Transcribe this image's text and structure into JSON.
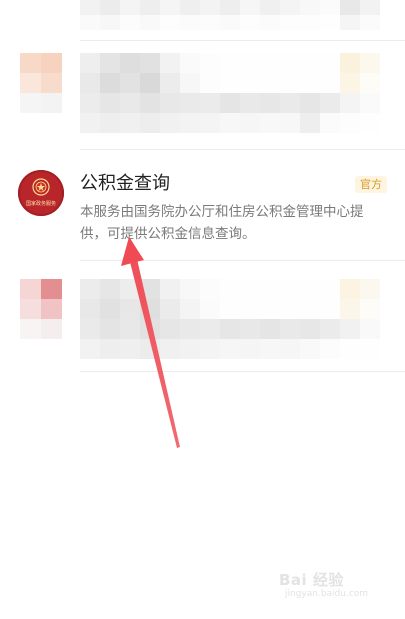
{
  "result_item": {
    "title": "公积金查询",
    "badge": "官方",
    "description": "本服务由国务院办公厅和住房公积金管理中心提供，可提供公积金信息查询。",
    "emblem_text": "国家政务服务"
  },
  "watermark": {
    "main": "Bai 经验",
    "sub": "jingyan.baidu.com"
  },
  "colors": {
    "emblem_red": "#b8262c",
    "badge_text": "#d99a1c",
    "arrow": "#ef4b55"
  }
}
